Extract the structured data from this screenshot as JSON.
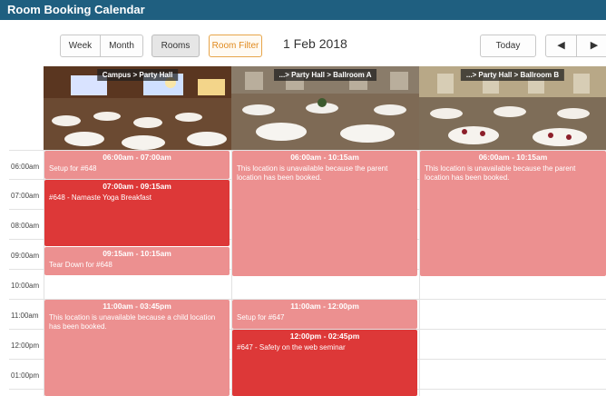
{
  "app": {
    "title": "Room Booking Calendar"
  },
  "toolbar": {
    "week": "Week",
    "month": "Month",
    "rooms": "Rooms",
    "room_filter": "Room Filter",
    "date": "1 Feb 2018",
    "today": "Today",
    "prev": "◀",
    "next": "▶"
  },
  "rooms": [
    {
      "label": "Campus > Party Hall"
    },
    {
      "label": "...> Party Hall > Ballroom A"
    },
    {
      "label": "...> Party Hall > Ballroom B"
    }
  ],
  "times": [
    "06:00am",
    "07:00am",
    "08:00am",
    "09:00am",
    "10:00am",
    "11:00am",
    "12:00pm",
    "01:00pm"
  ],
  "events": [
    {
      "time": "06:00am - 07:00am",
      "text": "Setup for #648"
    },
    {
      "time": "07:00am - 09:15am",
      "text": "#648 - Namaste Yoga Breakfast"
    },
    {
      "time": "09:15am - 10:15am",
      "text": "Tear Down for #648"
    },
    {
      "time": "11:00am - 03:45pm",
      "text": "This location is unavailable because a child location has been booked."
    },
    {
      "time": "06:00am - 10:15am",
      "text": "This location is unavailable because the parent location has been booked."
    },
    {
      "time": "11:00am - 12:00pm",
      "text": "Setup for #647"
    },
    {
      "time": "12:00pm - 02:45pm",
      "text": "#647 - Safety on the web seminar"
    },
    {
      "time": "06:00am - 10:15am",
      "text": "This location is unavailable because the parent location has been booked."
    }
  ],
  "colors": {
    "header": "#1f5f80",
    "event_light": "#ec9090",
    "event_dark": "#dd3838",
    "filter_accent": "#e08a1e"
  }
}
